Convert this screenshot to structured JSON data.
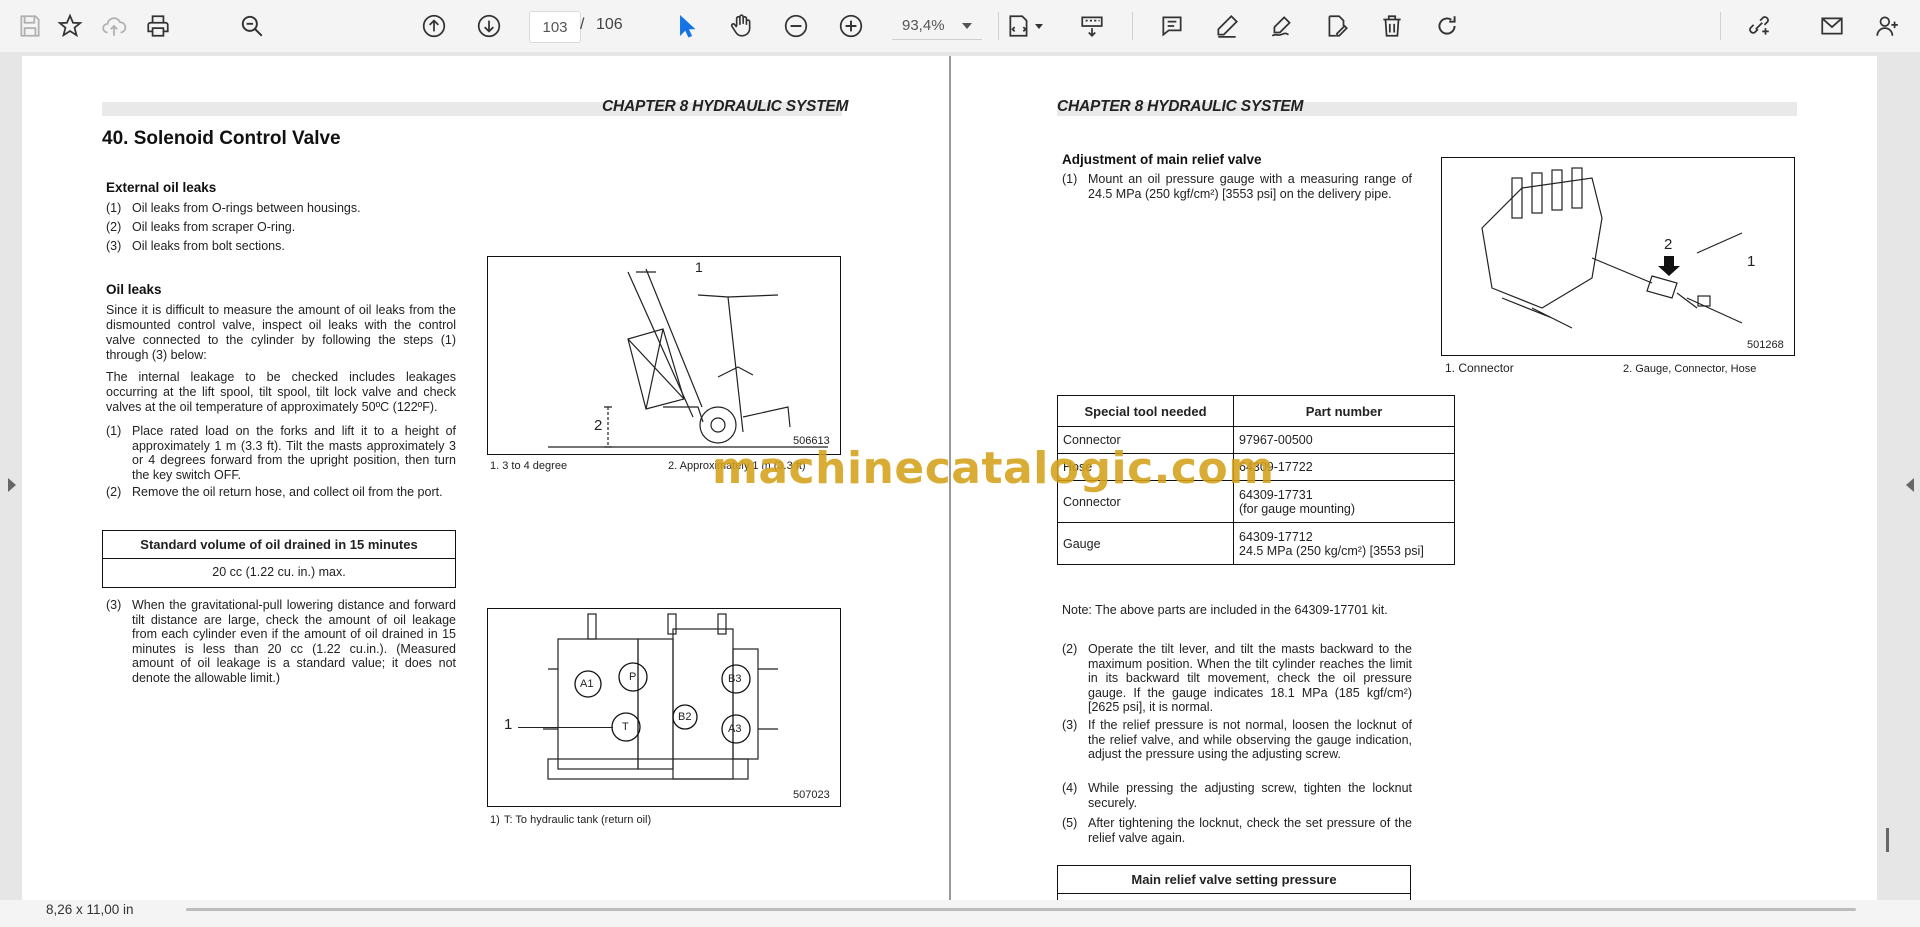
{
  "toolbar": {
    "page_current": "103",
    "page_sep": "/",
    "page_total": "106",
    "zoom": "93,4%"
  },
  "status": {
    "page_size": "8,26 x 11,00 in"
  },
  "watermark": "machinecatalogic.com",
  "left_page": {
    "chapter": "CHAPTER 8 HYDRAULIC SYSTEM",
    "title": "40.  Solenoid Control Valve",
    "external_heading": "External oil leaks",
    "external_items": [
      {
        "num": "(1)",
        "text": "Oil leaks from O-rings between housings."
      },
      {
        "num": "(2)",
        "text": "Oil leaks from scraper O-ring."
      },
      {
        "num": "(3)",
        "text": "Oil leaks from bolt sections."
      }
    ],
    "oil_heading": "Oil leaks",
    "oil_para1": "Since it is difficult to measure the amount of oil leaks from the dismounted control valve, inspect oil leaks with the control valve connected to the cylinder by following the steps (1) through (3) below:",
    "oil_para2": "The internal leakage to be checked includes leakages occurring at the lift spool, tilt spool, tilt lock valve and check valves at the oil temperature of approximately 50ºC (122ºF).",
    "steps": [
      {
        "num": "(1)",
        "text": "Place rated load on the forks and lift it to a height of approximately 1 m (3.3 ft). Tilt the masts approximately 3 or 4 degrees forward from the upright position, then turn the key switch OFF."
      },
      {
        "num": "(2)",
        "text": "Remove the oil return hose, and collect oil from the port."
      },
      {
        "num": "(3)",
        "text": "When the gravitational-pull lowering distance and forward tilt distance are large, check the amount of oil leakage from each cylinder even if the amount of oil drained in 15 minutes is less than 20 cc (1.22 cu.in.). (Measured amount of oil leakage is a standard value; it does not denote the allowable limit.)"
      }
    ],
    "std_box": {
      "header": "Standard volume of oil drained in 15 minutes",
      "value": "20 cc (1.22 cu. in.) max."
    },
    "fig1": {
      "label1": "1",
      "label2": "2",
      "number": "506613",
      "cap1": "1.  3 to 4 degree",
      "cap2": "2.  Approximately 1 m (3.3 ft)"
    },
    "fig2": {
      "label1": "1",
      "number": "507023",
      "port_a1": "A1",
      "port_p": "P",
      "port_b3": "B3",
      "port_t": "T",
      "port_b2": "B2",
      "port_a3": "A3",
      "cap_num": "1)",
      "cap_text": "T: To hydraulic tank (return oil)"
    }
  },
  "right_page": {
    "chapter": "CHAPTER 8 HYDRAULIC SYSTEM",
    "adj_heading": "Adjustment of main relief valve",
    "adj_step1": {
      "num": "(1)",
      "text": "Mount an oil pressure gauge with a measuring range of 24.5 MPa (250 kgf/cm²) [3553 psi] on the delivery pipe."
    },
    "fig3": {
      "label1": "1",
      "label2": "2",
      "number": "501268",
      "cap1": "1.  Connector",
      "cap2": "2.  Gauge, Connector, Hose"
    },
    "tools_table": {
      "headers": [
        "Special tool needed",
        "Part number"
      ],
      "rows": [
        {
          "tool": "Connector",
          "part": "97967-00500"
        },
        {
          "tool": "Hose",
          "part": "64309-17722"
        },
        {
          "tool": "Connector",
          "part": "64309-17731",
          "part2": "(for gauge mounting)"
        },
        {
          "tool": "Gauge",
          "part": "64309-17712",
          "part2": "24.5 MPa (250 kg/cm²) [3553 psi]"
        }
      ]
    },
    "note": "Note: The above parts are included in the 64309-17701 kit.",
    "steps": [
      {
        "num": "(2)",
        "text": "Operate the tilt lever, and tilt the masts backward to the maximum position. When the tilt cylinder reaches the limit in its backward tilt movement, check the oil pressure gauge. If the gauge indicates 18.1 MPa (185 kgf/cm²) [2625 psi], it is normal."
      },
      {
        "num": "(3)",
        "text": "If the relief pressure is not normal, loosen the locknut of the relief valve, and while observing the gauge indication, adjust the pressure using the adjusting screw."
      },
      {
        "num": "(4)",
        "text": "While pressing the adjusting screw, tighten the locknut securely."
      },
      {
        "num": "(5)",
        "text": "After tightening the locknut, check the set pressure of the relief valve again."
      }
    ],
    "setting_box_header": "Main relief valve setting pressure"
  }
}
